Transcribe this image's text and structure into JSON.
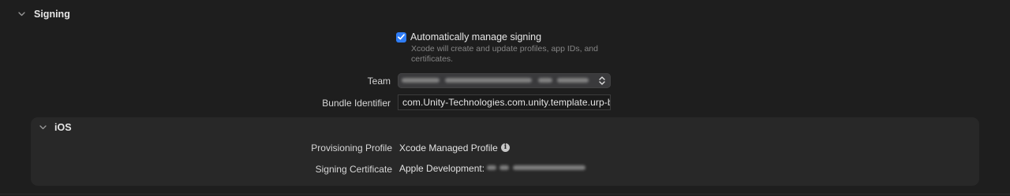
{
  "signing": {
    "title": "Signing",
    "auto_manage": {
      "label": "Automatically manage signing",
      "checked": true,
      "helper": "Xcode will create and update profiles, app IDs, and certificates."
    },
    "team": {
      "label": "Team",
      "value_redacted": true
    },
    "bundle_identifier": {
      "label": "Bundle Identifier",
      "value": "com.Unity-Technologies.com.unity.template.urp-b"
    }
  },
  "ios": {
    "title": "iOS",
    "provisioning_profile": {
      "label": "Provisioning Profile",
      "value": "Xcode Managed Profile",
      "icon": "info-icon"
    },
    "signing_certificate": {
      "label": "Signing Certificate",
      "value": "Apple Development:",
      "value_redacted": true
    }
  },
  "colors": {
    "background": "#1e1e1e",
    "panel": "#282828",
    "accent": "#2f7df6"
  }
}
